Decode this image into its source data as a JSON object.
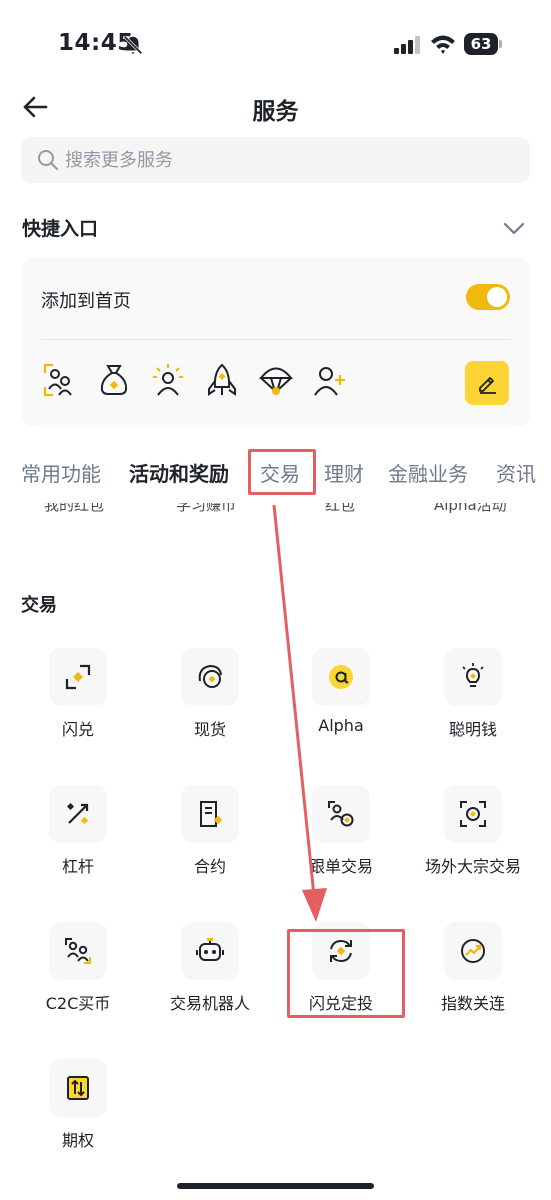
{
  "status_bar": {
    "time": "14:45",
    "battery": "63",
    "icons": [
      "bell-slash-icon",
      "signal-icon",
      "wifi-icon",
      "battery-icon"
    ]
  },
  "header": {
    "title": "服务",
    "back_icon": "arrow-left-icon"
  },
  "search": {
    "placeholder": "搜索更多服务"
  },
  "quick_access": {
    "title": "快捷入口",
    "add_to_home_label": "添加到首页",
    "toggle_on": true,
    "shortcut_icons": [
      "user-scan-icon",
      "money-bag-icon",
      "sun-user-icon",
      "rocket-icon",
      "parachute-icon",
      "add-user-icon"
    ],
    "edit_icon": "pencil-icon"
  },
  "tabs": [
    {
      "label": "常用功能",
      "bold": false
    },
    {
      "label": "活动和奖励",
      "bold": true
    },
    {
      "label": "交易",
      "bold": false
    },
    {
      "label": "理财",
      "bold": false
    },
    {
      "label": "金融业务",
      "bold": false
    },
    {
      "label": "资讯",
      "bold": false
    }
  ],
  "cut_row": [
    "我的红包",
    "学习赚币",
    "红包",
    "Alpha活动"
  ],
  "trade_section": {
    "title": "交易",
    "items": [
      {
        "label": "闪兑",
        "icon": "convert-icon"
      },
      {
        "label": "现货",
        "icon": "spot-icon"
      },
      {
        "label": "Alpha",
        "icon": "alpha-icon"
      },
      {
        "label": "聪明钱",
        "icon": "lightbulb-icon"
      },
      {
        "label": "杠杆",
        "icon": "percent-icon"
      },
      {
        "label": "合约",
        "icon": "document-icon"
      },
      {
        "label": "跟单交易",
        "icon": "copy-trade-icon"
      },
      {
        "label": "场外大宗交易",
        "icon": "otc-icon"
      },
      {
        "label": "C2C买币",
        "icon": "c2c-icon"
      },
      {
        "label": "交易机器人",
        "icon": "robot-icon"
      },
      {
        "label": "闪兑定投",
        "icon": "auto-invest-icon"
      },
      {
        "label": "指数关连",
        "icon": "index-link-icon"
      },
      {
        "label": "期权",
        "icon": "options-icon"
      }
    ]
  },
  "colors": {
    "accent": "#f0b90b",
    "annotation": "#e45f62",
    "text": "#1e2329",
    "muted": "#707a8a"
  }
}
